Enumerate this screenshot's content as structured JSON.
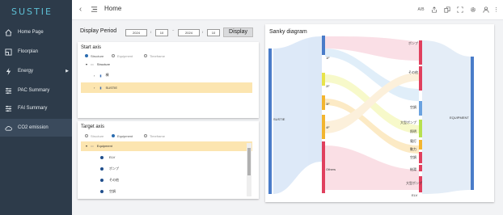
{
  "app": {
    "logo": "SUSTIE",
    "page_title": "Home"
  },
  "sidebar": {
    "items": [
      {
        "label": "Home Page"
      },
      {
        "label": "Floorplan"
      },
      {
        "label": "Energy"
      },
      {
        "label": "PAC Summary"
      },
      {
        "label": "FAI Summary"
      },
      {
        "label": "CO2 emission"
      }
    ]
  },
  "topbar": {
    "lang": "A/B"
  },
  "display_period": {
    "label": "Display Period",
    "start_year": "2024",
    "start_month": "10",
    "end_year": "2024",
    "end_month": "10",
    "separator": "~",
    "slash": "/",
    "button": "Display"
  },
  "start_axis": {
    "title": "Start axis",
    "options": [
      "Structure",
      "Equipment",
      "Timeframe"
    ],
    "tree_root": "Structure",
    "children": [
      "棟",
      "SUSTIE"
    ]
  },
  "target_axis": {
    "title": "Target axis",
    "options": [
      "Structure",
      "Equipment",
      "Timeframe"
    ],
    "tree_root": "Equipment",
    "children": [
      "ELV",
      "ポンプ",
      "その他",
      "空調"
    ]
  },
  "sankey": {
    "title": "Sanky diagram",
    "left": "SUSTIE",
    "mid": [
      "1F",
      "2F",
      "3F",
      "4F",
      "Others"
    ],
    "right_labels": [
      "ポンプ",
      "その他",
      "空調",
      "大型ポンプ",
      "照明",
      "電灯",
      "動力",
      "空調",
      "給湯",
      "大型ポンプ",
      "ELV"
    ],
    "right_label_top": "EQUIPMENT",
    "far_right": "EQUIPMENT"
  }
}
